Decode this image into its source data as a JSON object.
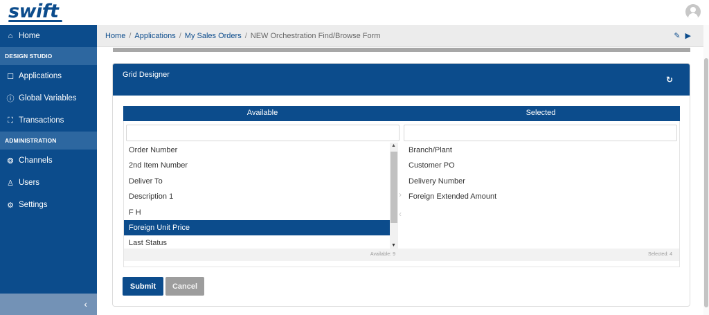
{
  "app": {
    "logo": "swift"
  },
  "sidebar": {
    "items": [
      {
        "label": "Home",
        "icon": "home-icon",
        "glyph": "⌂"
      },
      {
        "section": "DESIGN STUDIO"
      },
      {
        "label": "Applications",
        "icon": "applications-icon",
        "glyph": "☐"
      },
      {
        "label": "Global Variables",
        "icon": "info-icon",
        "glyph": "ⓘ"
      },
      {
        "label": "Transactions",
        "icon": "transactions-icon",
        "glyph": "⛶"
      },
      {
        "section": "ADMINISTRATION"
      },
      {
        "label": "Channels",
        "icon": "channels-icon",
        "glyph": "❂"
      },
      {
        "label": "Users",
        "icon": "user-icon",
        "glyph": "♙"
      },
      {
        "label": "Settings",
        "icon": "gear-icon",
        "glyph": "⚙"
      }
    ],
    "collapse_glyph": "‹"
  },
  "breadcrumb": {
    "links": [
      "Home",
      "Applications",
      "My Sales Orders"
    ],
    "current": "NEW Orchestration Find/Browse Form",
    "separator": "/",
    "edit_glyph": "✎",
    "play_glyph": "▶"
  },
  "grid_designer": {
    "title": "Grid Designer",
    "refresh_glyph": "↻",
    "available_header": "Available",
    "selected_header": "Selected",
    "available_filter_value": "",
    "selected_filter_value": "",
    "available_items": [
      "Order Number",
      "2nd Item Number",
      "Deliver To",
      "Description 1",
      "F H",
      "Foreign Unit Price",
      "Last Status"
    ],
    "selected_available_item": "Foreign Unit Price",
    "selected_items": [
      "Branch/Plant",
      "Customer PO",
      "Delivery Number",
      "Foreign Extended Amount"
    ],
    "available_count": "Available: 9",
    "selected_count": "Selected: 4",
    "move_right_glyph": "›",
    "move_left_glyph": "‹"
  },
  "actions": {
    "submit_label": "Submit",
    "cancel_label": "Cancel"
  },
  "colors": {
    "brand": "#0c4c8c",
    "section": "#2d67a0",
    "cancel": "#9d9d9d"
  }
}
